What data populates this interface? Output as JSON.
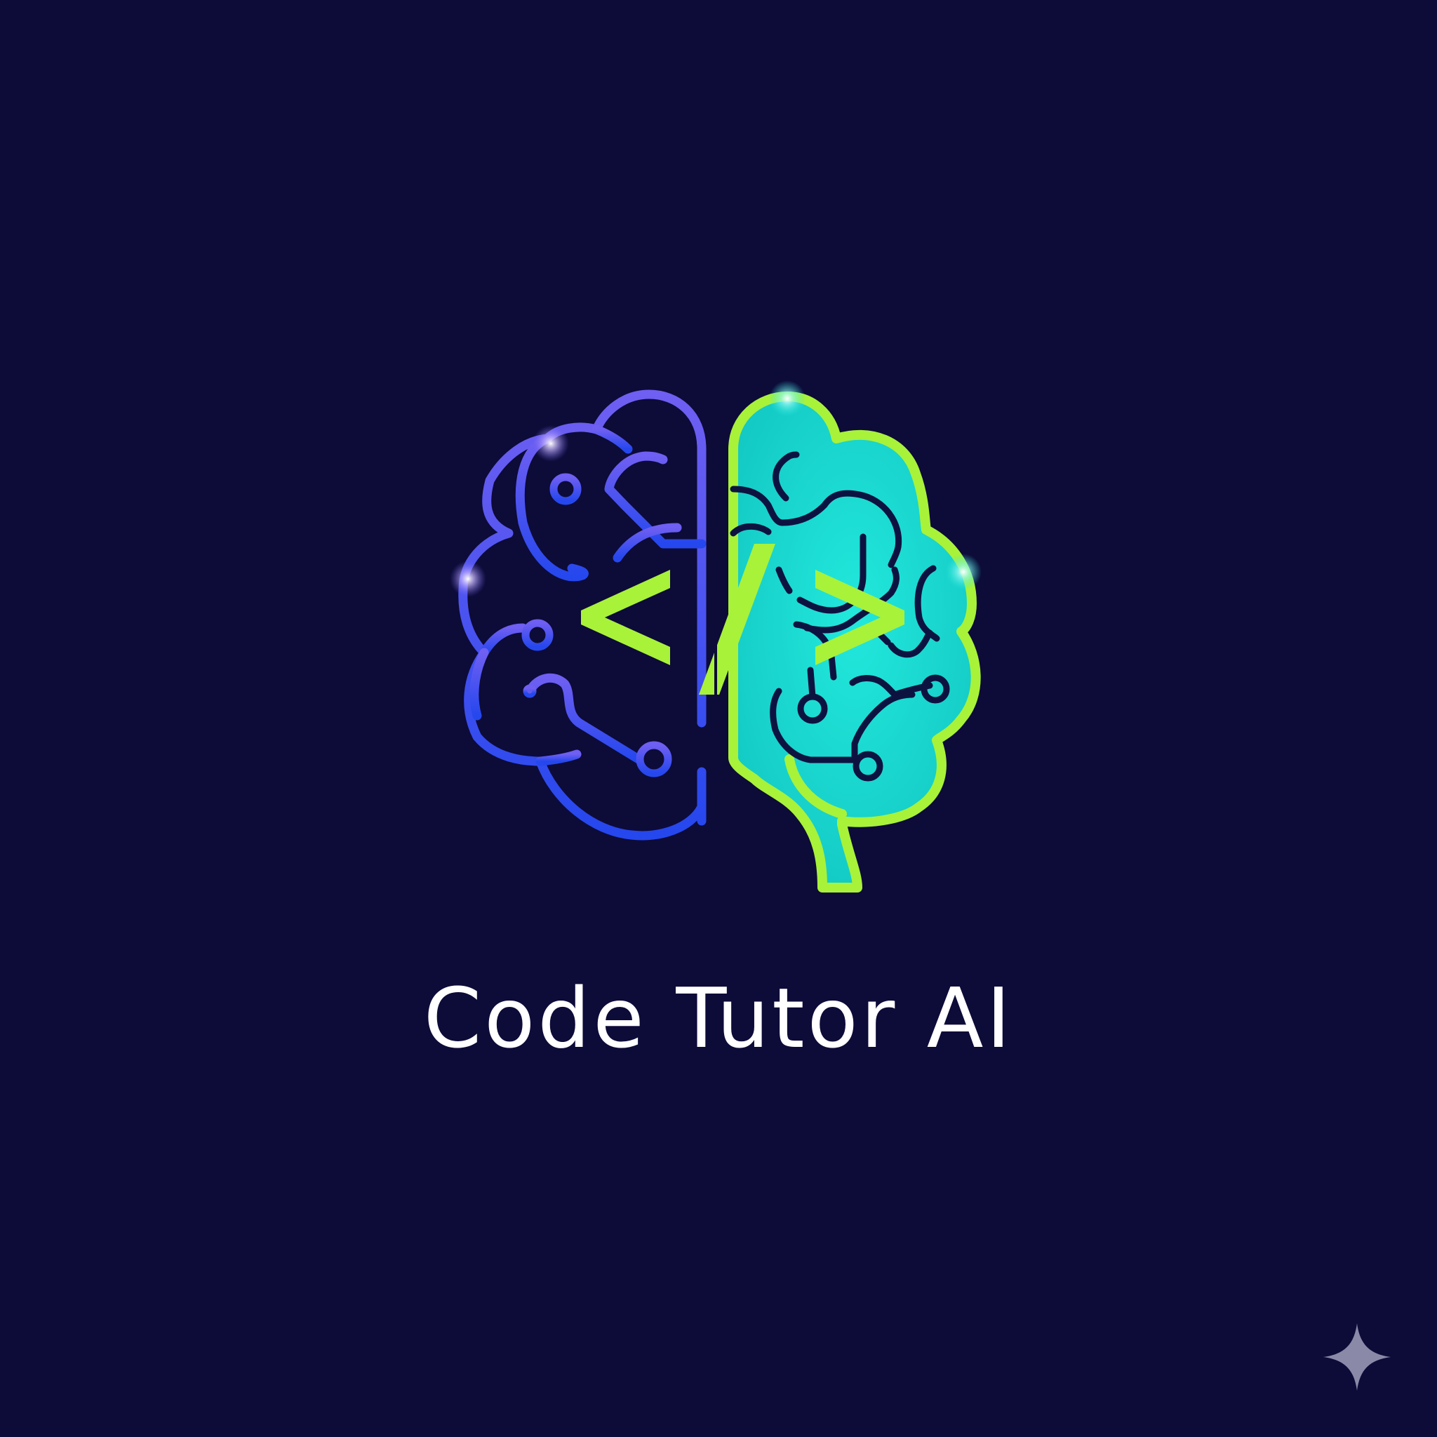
{
  "brand": {
    "title": "Code Tutor AI",
    "code_symbol": "</>"
  },
  "icons": {
    "logo": "brain-circuit-code-icon",
    "corner": "sparkle-icon"
  },
  "colors": {
    "background": "#0d0b38",
    "left_brain_top": "#6a5cf0",
    "left_brain_bottom": "#2a4df0",
    "right_brain_fill": "#1fe0d6",
    "right_brain_outline": "#a8f23a",
    "code_symbol": "#a8f23a",
    "title": "#ffffff",
    "sparkle": "#8a8aa8"
  }
}
